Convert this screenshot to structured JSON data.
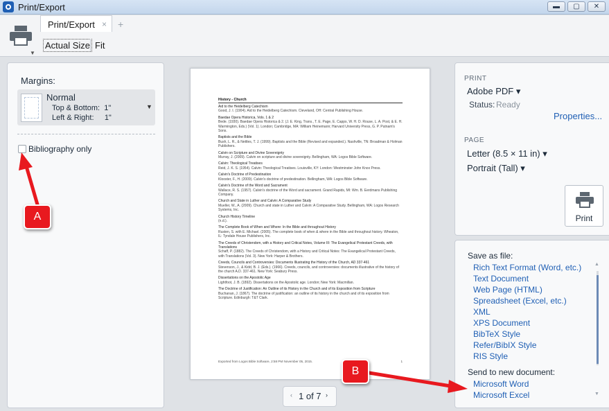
{
  "window": {
    "title": "Print/Export",
    "min_glyph": "▬",
    "max_glyph": "▢",
    "close_glyph": "✕"
  },
  "toolbar": {
    "tab_label": "Print/Export",
    "tab_close_glyph": "×",
    "new_tab_glyph": "+",
    "zoom_actual": "Actual Size",
    "zoom_fit": "Fit",
    "printer_icon": "printer-icon"
  },
  "left_panel": {
    "margins_label": "Margins:",
    "margins_value": "Normal",
    "top_bottom": "Top & Bottom:  1\"",
    "left_right": "Left & Right:     1\"",
    "bibliography_only_label": "Bibliography only",
    "bibliography_only_checked": false
  },
  "preview": {
    "heading": "History - Church",
    "entries": [
      {
        "title": "Aid to the Heidelberg Catechism",
        "cite": "Good, J. I. (1904). Aid to the Heidelberg Catechism. Cleveland, OH: Central Publishing House."
      },
      {
        "title": "Baedae Opera Historica, Vols. 1 & 2",
        "cite": "Bede. (1930). Baedae Opera Historica & 2. (J. E. King, Trans., T. E. Page, E. Capps, W. H. D. Rouse, L. A. Post, & E. H. Warmington, Eds.) (Vol. 1). London; Cambridge, MA: William Heinemann; Harvard University Press, G. P. Putnam's Sons."
      },
      {
        "title": "Baptists and the Bible",
        "cite": "Bush, L. R., & Nettles, T. J. (1999). Baptists and the Bible (Revised and expanded.). Nashville, TN: Broadman & Holman Publishers."
      },
      {
        "title": "Calvin on Scripture and Divine Sovereignty",
        "cite": "Murray, J. (2009). Calvin on scripture and divine sovereignty. Bellingham, WA: Logos Bible Software."
      },
      {
        "title": "Calvin: Theological Treatises",
        "cite": "Reid, J. K. S. (1954). Calvin: Theological Treatises. Louisville, KY: London: Westminster John Knox Press."
      },
      {
        "title": "Calvin's Doctrine of Predestination",
        "cite": "Klooster, F., H. (2009). Calvin's doctrine of predestination. Bellingham, WA: Logos Bible Software."
      },
      {
        "title": "Calvin's Doctrine of the Word and Sacrament",
        "cite": "Wallace, R. S. (1957). Calvin's doctrine of the Word and sacrament. Grand Rapids, MI: Wm. B. Eerdmans Publishing Company."
      },
      {
        "title": "Church and State in Luther and Calvin: A Comparative Study",
        "cite": "Mueller, W., A. (2009). Church and state in Luther and Calvin: A Comparative Study. Bellingham, WA: Logos Research Systems, Inc."
      },
      {
        "title": "Church History Timeline",
        "cite": "(n.d.)."
      },
      {
        "title": "The Complete Book of When and Where: In the Bible and throughout History",
        "cite": "Rusten, S. with E. Michael. (2005). The complete book of when & where in the Bible and throughout history. Wheaton, IL: Tyndale House Publishers, Inc."
      },
      {
        "title": "The Creeds of Christendom, with a History and Critical Notes, Volume III: The Evangelical Protestant Creeds, with Translations",
        "cite": "Schaff, P. (1882). The Creeds of Christendom, with a History and Critical Notes: The Evangelical Protestant Creeds, with Translations (Vol. 3). New York: Harper & Brothers."
      },
      {
        "title": "Creeds, Councils and Controversies: Documents Illustrating the History of the Church, AD 337-461",
        "cite": "Stevenson, J., & Kidd, B. J. (Eds.). (1966). Creeds, councils, and controversies: documents illustrative of the history of the church A.D. 337-461. New York: Seabury Press."
      },
      {
        "title": "Dissertations on the Apostolic Age",
        "cite": "Lightfoot, J. B. (1892). Dissertations on the Apostolic age. London; New York: Macmillan."
      },
      {
        "title": "The Doctrine of Justification: An Outline of its History in the Church and of its Exposition from Scripture",
        "cite": "Buchanan, J. (1867). The doctrine of justification: an outline of its history in the church and of its exposition from Scripture. Edinburgh: T&T Clark."
      }
    ],
    "footer": "Exported from Logos Bible Software, 2:58 PM November 05, 2015.",
    "footer_page": "1",
    "pager_text": "1 of 7",
    "pager_prev": "‹",
    "pager_next": "›"
  },
  "print_panel": {
    "heading": "PRINT",
    "printer": "Adobe PDF ▾",
    "status_key": "Status:",
    "status_value": "Ready",
    "properties_link": "Properties...",
    "page_heading": "PAGE",
    "paper": "Letter (8.5 × 11 in) ▾",
    "orientation": "Portrait (Tall) ▾",
    "print_button": "Print"
  },
  "save_panel": {
    "save_heading": "Save as file:",
    "save_items": [
      "Rich Text Format (Word, etc.)",
      "Text Document",
      "Web Page (HTML)",
      "Spreadsheet (Excel, etc.)",
      "XML",
      "XPS Document",
      "BibTeX Style",
      "Refer/BibIX Style",
      "RIS Style"
    ],
    "send_heading": "Send to new document:",
    "send_items": [
      "Microsoft Word",
      "Microsoft Excel"
    ]
  },
  "annotations": {
    "callout_a": "A",
    "callout_b": "B",
    "arrow_color": "#e8191f"
  },
  "colors": {
    "link": "#1f5fb4",
    "panel_bg": "#f8f9fa",
    "chrome_bg": "#dfe2e6"
  }
}
